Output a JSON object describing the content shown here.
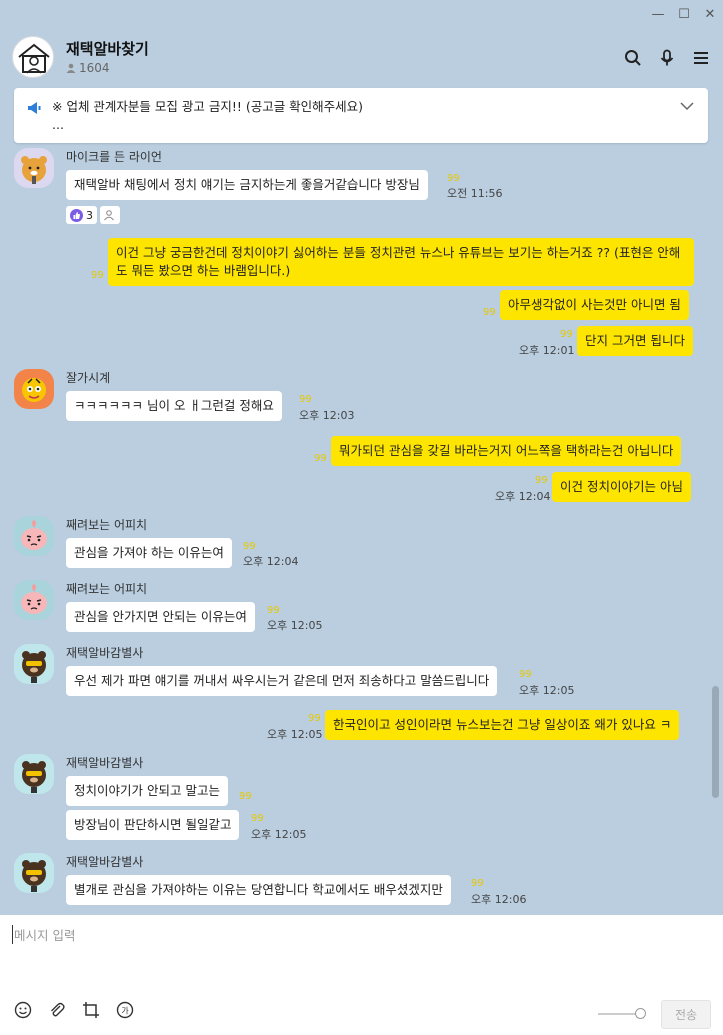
{
  "window": {
    "min": "—",
    "max": "☐",
    "close": "✕"
  },
  "header": {
    "title": "재택알바찾기",
    "members": "1604"
  },
  "notice": {
    "text": "※ 업체 관계자분들 모집 광고 금지!! (공고글 확인해주세요)\n..."
  },
  "messages": {
    "m1": {
      "nick": "마이크를 든 라이언",
      "text": "재택알바 채팅에서 정치 얘기는 금지하는게 좋을거같습니다 방장님",
      "unread": "99",
      "time": "오전 11:56",
      "reaction_count": "3"
    },
    "m2": {
      "text": "이건 그냥 궁금한건데 정치이야기 싫어하는 분들 정치관련 뉴스나 유튜브는 보기는 하는거죠 ?? (표현은 안해도 뭐든 봤으면 하는 바램입니다.)",
      "unread": "99"
    },
    "m3": {
      "text": "아무생각없이 사는것만 아니면 됨",
      "unread": "99"
    },
    "m4": {
      "text": "단지 그거면 됩니다",
      "unread": "99",
      "time": "오후 12:01"
    },
    "m5": {
      "nick": "잘가시계",
      "text": "ㅋㅋㅋㅋㅋㅋ 님이 오 ㅐ그런걸 정해요",
      "unread": "99",
      "time": "오후 12:03"
    },
    "m6": {
      "text": "뭐가되던 관심을 갖길 바라는거지 어느쪽을 택하라는건 아닙니다",
      "unread": "99"
    },
    "m7": {
      "text": "이건 정치이야기는 아님",
      "unread": "99",
      "time": "오후 12:04"
    },
    "m8": {
      "nick": "째려보는 어피치",
      "text": "관심을 가져야 하는 이유는여",
      "unread": "99",
      "time": "오후 12:04"
    },
    "m9": {
      "nick": "째려보는 어피치",
      "text": "관심을 안가지면 안되는 이유는여",
      "unread": "99",
      "time": "오후 12:05"
    },
    "m10": {
      "nick": "재택알바감별사",
      "text": "우선 제가 파면 얘기를 꺼내서 싸우시는거 같은데 먼저 죄송하다고 말씀드립니다",
      "unread": "99",
      "time": "오후 12:05"
    },
    "m11": {
      "text": "한국인이고 성인이라면 뉴스보는건 그냥 일상이죠 왜가 있나요 ㅋ",
      "unread": "99",
      "time": "오후 12:05"
    },
    "m12": {
      "nick": "재택알바감별사",
      "text": "정치이야기가 안되고 말고는",
      "unread": "99"
    },
    "m13": {
      "text": "방장님이 판단하시면 될일같고",
      "unread": "99",
      "time": "오후 12:05"
    },
    "m14": {
      "nick": "재택알바감별사",
      "text": "별개로 관심을 가져야하는 이유는 당연합니다 학교에서도 배우셨겠지만",
      "unread": "99",
      "time": "오후 12:06"
    }
  },
  "input": {
    "placeholder": "메시지 입력",
    "send": "전송"
  },
  "colors": {
    "background": "#bacee0",
    "my_bubble": "#fee500",
    "their_bubble": "#ffffff"
  }
}
